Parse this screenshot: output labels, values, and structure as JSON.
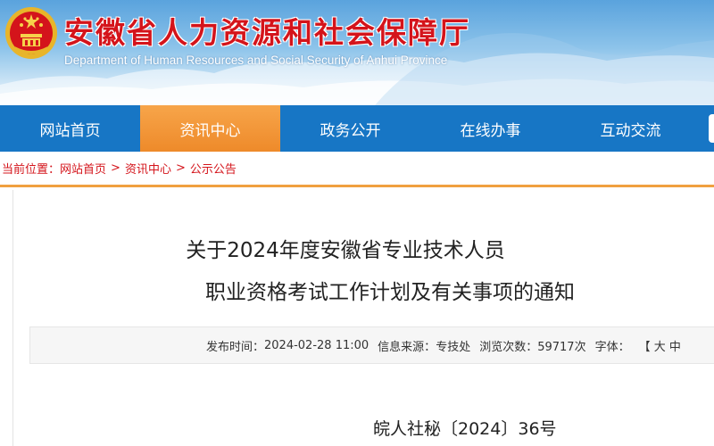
{
  "header": {
    "title": "安徽省人力资源和社会保障厅",
    "subtitle": "Department of Human Resources and Social Security of Anhui Province",
    "emblem_icon": "national-emblem-icon"
  },
  "nav": {
    "items": [
      {
        "label": "网站首页"
      },
      {
        "label": "资讯中心"
      },
      {
        "label": "政务公开"
      },
      {
        "label": "在线办事"
      },
      {
        "label": "互动交流"
      }
    ],
    "active_index": 1
  },
  "breadcrumb": {
    "prefix": "当前位置：",
    "items": [
      "网站首页",
      "资讯中心",
      "公示公告"
    ],
    "separator": ">"
  },
  "article": {
    "title_line1": "关于2024年度安徽省专业技术人员",
    "title_line2": "职业资格考试工作计划及有关事项的通知",
    "meta": {
      "published_label": "发布时间：",
      "published_value": "2024-02-28 11:00",
      "source_label": "信息来源：",
      "source_value": "专技处",
      "views_label": "浏览次数：",
      "views_value": "59717次",
      "font_label": "字体：",
      "font_value": "【 大 中"
    },
    "doc_number": "皖人社秘〔2024〕36号"
  },
  "colors": {
    "nav_bg": "#1776c5",
    "nav_active": "#ee8a2a",
    "title_red": "#d4141b",
    "breadcrumb_border": "#f0a040"
  }
}
